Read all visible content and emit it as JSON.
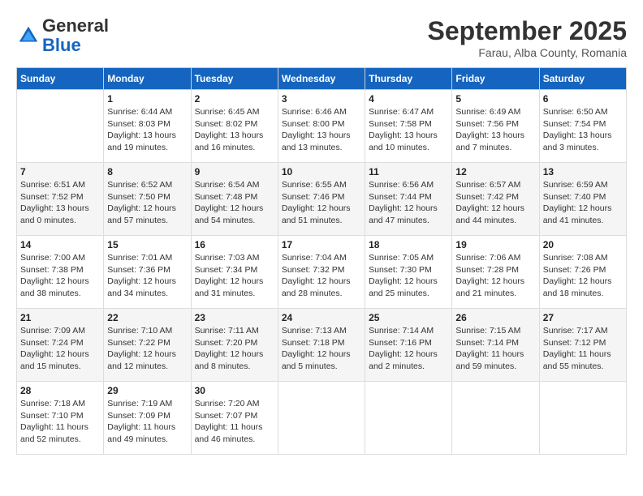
{
  "logo": {
    "general": "General",
    "blue": "Blue"
  },
  "header": {
    "month": "September 2025",
    "location": "Farau, Alba County, Romania"
  },
  "weekdays": [
    "Sunday",
    "Monday",
    "Tuesday",
    "Wednesday",
    "Thursday",
    "Friday",
    "Saturday"
  ],
  "weeks": [
    [
      {
        "day": "",
        "info": ""
      },
      {
        "day": "1",
        "info": "Sunrise: 6:44 AM\nSunset: 8:03 PM\nDaylight: 13 hours\nand 19 minutes."
      },
      {
        "day": "2",
        "info": "Sunrise: 6:45 AM\nSunset: 8:02 PM\nDaylight: 13 hours\nand 16 minutes."
      },
      {
        "day": "3",
        "info": "Sunrise: 6:46 AM\nSunset: 8:00 PM\nDaylight: 13 hours\nand 13 minutes."
      },
      {
        "day": "4",
        "info": "Sunrise: 6:47 AM\nSunset: 7:58 PM\nDaylight: 13 hours\nand 10 minutes."
      },
      {
        "day": "5",
        "info": "Sunrise: 6:49 AM\nSunset: 7:56 PM\nDaylight: 13 hours\nand 7 minutes."
      },
      {
        "day": "6",
        "info": "Sunrise: 6:50 AM\nSunset: 7:54 PM\nDaylight: 13 hours\nand 3 minutes."
      }
    ],
    [
      {
        "day": "7",
        "info": "Sunrise: 6:51 AM\nSunset: 7:52 PM\nDaylight: 13 hours\nand 0 minutes."
      },
      {
        "day": "8",
        "info": "Sunrise: 6:52 AM\nSunset: 7:50 PM\nDaylight: 12 hours\nand 57 minutes."
      },
      {
        "day": "9",
        "info": "Sunrise: 6:54 AM\nSunset: 7:48 PM\nDaylight: 12 hours\nand 54 minutes."
      },
      {
        "day": "10",
        "info": "Sunrise: 6:55 AM\nSunset: 7:46 PM\nDaylight: 12 hours\nand 51 minutes."
      },
      {
        "day": "11",
        "info": "Sunrise: 6:56 AM\nSunset: 7:44 PM\nDaylight: 12 hours\nand 47 minutes."
      },
      {
        "day": "12",
        "info": "Sunrise: 6:57 AM\nSunset: 7:42 PM\nDaylight: 12 hours\nand 44 minutes."
      },
      {
        "day": "13",
        "info": "Sunrise: 6:59 AM\nSunset: 7:40 PM\nDaylight: 12 hours\nand 41 minutes."
      }
    ],
    [
      {
        "day": "14",
        "info": "Sunrise: 7:00 AM\nSunset: 7:38 PM\nDaylight: 12 hours\nand 38 minutes."
      },
      {
        "day": "15",
        "info": "Sunrise: 7:01 AM\nSunset: 7:36 PM\nDaylight: 12 hours\nand 34 minutes."
      },
      {
        "day": "16",
        "info": "Sunrise: 7:03 AM\nSunset: 7:34 PM\nDaylight: 12 hours\nand 31 minutes."
      },
      {
        "day": "17",
        "info": "Sunrise: 7:04 AM\nSunset: 7:32 PM\nDaylight: 12 hours\nand 28 minutes."
      },
      {
        "day": "18",
        "info": "Sunrise: 7:05 AM\nSunset: 7:30 PM\nDaylight: 12 hours\nand 25 minutes."
      },
      {
        "day": "19",
        "info": "Sunrise: 7:06 AM\nSunset: 7:28 PM\nDaylight: 12 hours\nand 21 minutes."
      },
      {
        "day": "20",
        "info": "Sunrise: 7:08 AM\nSunset: 7:26 PM\nDaylight: 12 hours\nand 18 minutes."
      }
    ],
    [
      {
        "day": "21",
        "info": "Sunrise: 7:09 AM\nSunset: 7:24 PM\nDaylight: 12 hours\nand 15 minutes."
      },
      {
        "day": "22",
        "info": "Sunrise: 7:10 AM\nSunset: 7:22 PM\nDaylight: 12 hours\nand 12 minutes."
      },
      {
        "day": "23",
        "info": "Sunrise: 7:11 AM\nSunset: 7:20 PM\nDaylight: 12 hours\nand 8 minutes."
      },
      {
        "day": "24",
        "info": "Sunrise: 7:13 AM\nSunset: 7:18 PM\nDaylight: 12 hours\nand 5 minutes."
      },
      {
        "day": "25",
        "info": "Sunrise: 7:14 AM\nSunset: 7:16 PM\nDaylight: 12 hours\nand 2 minutes."
      },
      {
        "day": "26",
        "info": "Sunrise: 7:15 AM\nSunset: 7:14 PM\nDaylight: 11 hours\nand 59 minutes."
      },
      {
        "day": "27",
        "info": "Sunrise: 7:17 AM\nSunset: 7:12 PM\nDaylight: 11 hours\nand 55 minutes."
      }
    ],
    [
      {
        "day": "28",
        "info": "Sunrise: 7:18 AM\nSunset: 7:10 PM\nDaylight: 11 hours\nand 52 minutes."
      },
      {
        "day": "29",
        "info": "Sunrise: 7:19 AM\nSunset: 7:09 PM\nDaylight: 11 hours\nand 49 minutes."
      },
      {
        "day": "30",
        "info": "Sunrise: 7:20 AM\nSunset: 7:07 PM\nDaylight: 11 hours\nand 46 minutes."
      },
      {
        "day": "",
        "info": ""
      },
      {
        "day": "",
        "info": ""
      },
      {
        "day": "",
        "info": ""
      },
      {
        "day": "",
        "info": ""
      }
    ]
  ]
}
